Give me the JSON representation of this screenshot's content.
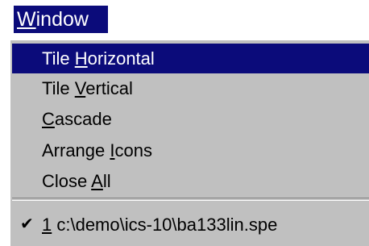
{
  "menubar": {
    "window_menu": {
      "mnemonic": "W",
      "rest": "indow"
    }
  },
  "menu": {
    "items": [
      {
        "pre": "Tile ",
        "mnemonic": "H",
        "post": "orizontal"
      },
      {
        "pre": "Tile ",
        "mnemonic": "V",
        "post": "ertical"
      },
      {
        "pre": "",
        "mnemonic": "C",
        "post": "ascade"
      },
      {
        "pre": "Arrange ",
        "mnemonic": "I",
        "post": "cons"
      },
      {
        "pre": "Close ",
        "mnemonic": "A",
        "post": "ll"
      }
    ],
    "window_list": [
      {
        "check": "✔",
        "pre": "",
        "mnemonic": "1",
        "post": " c:\\demo\\ics-10\\ba133lin.spe"
      }
    ]
  },
  "colors": {
    "highlight": "#0b0b7a",
    "menu_bg": "#c0c0c0"
  }
}
